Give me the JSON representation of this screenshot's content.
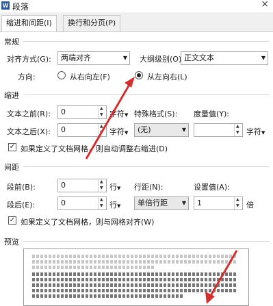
{
  "dialog": {
    "title": "段落",
    "close_glyph": "×",
    "app_icon": "W"
  },
  "tabs": [
    {
      "label": "缩进和间距(I)",
      "active": true
    },
    {
      "label": "换行和分页(P)",
      "active": false
    }
  ],
  "general": {
    "heading": "常规",
    "alignment_label": "对齐方式(G):",
    "alignment_value": "两端对齐",
    "outline_label": "大纲级别(O):",
    "outline_value": "正文文本",
    "direction_label": "方向:",
    "rtl_label": "从右向左(F)",
    "ltr_label": "从左向右(L)",
    "direction_selected": "ltr"
  },
  "indent": {
    "heading": "缩进",
    "before_label": "文本之前(R):",
    "before_value": "0",
    "before_unit": "字符",
    "after_label": "文本之后(X):",
    "after_value": "0",
    "after_unit": "字符",
    "special_label": "特殊格式(S):",
    "special_value": "(无)",
    "measure_label": "度量值(Y):",
    "measure_value": "",
    "measure_unit": "字符",
    "auto_adjust_label": "如果定义了文档网格，则自动调整右缩进(D)",
    "auto_adjust_checked": true
  },
  "spacing": {
    "heading": "间距",
    "before_label": "段前(B):",
    "before_value": "0",
    "before_unit": "行",
    "after_label": "段后(E):",
    "after_value": "0",
    "after_unit": "行",
    "line_label": "行距(N):",
    "line_value": "单倍行距",
    "setting_label": "设置值(A):",
    "setting_value": "1",
    "setting_unit": "倍",
    "snap_grid_label": "如果定义了文档网格，则与网格对齐(W)",
    "snap_grid_checked": true
  },
  "preview": {
    "heading": "预览"
  },
  "colors": {
    "annotation_arrow": "#d32f2f",
    "border": "#a8a8a8"
  }
}
